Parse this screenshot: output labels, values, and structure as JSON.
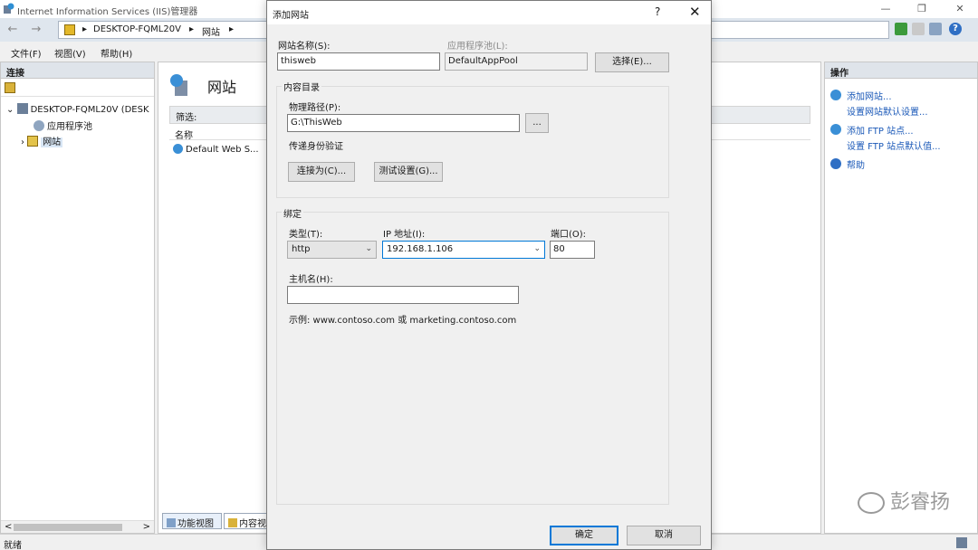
{
  "window": {
    "title": "Internet Information Services (IIS)管理器",
    "minimize_glyph": "—",
    "restore_glyph": "❐",
    "close_glyph": "✕"
  },
  "address": {
    "back_glyph": "←",
    "forward_glyph": "→",
    "sep_glyph": "▸",
    "crumbs": [
      "DESKTOP-FQML20V",
      "网站"
    ],
    "help_glyph": "?"
  },
  "menu": [
    "文件(F)",
    "视图(V)",
    "帮助(H)"
  ],
  "connections": {
    "header": "连接",
    "tree": {
      "server": "DESKTOP-FQML20V (DESK",
      "app_pools": "应用程序池",
      "sites": "网站"
    },
    "expand_glyph": "⌄",
    "collapse_glyph": "›",
    "scroll_left": "<",
    "scroll_right": ">"
  },
  "center": {
    "title": "网站",
    "filter_label": "筛选:",
    "column_name": "名称",
    "rows": [
      "Default Web S..."
    ],
    "tabs": [
      "功能视图",
      "内容视"
    ]
  },
  "actions": {
    "header": "操作",
    "items": [
      "添加网站...",
      "设置网站默认设置...",
      "添加 FTP 站点...",
      "设置 FTP 站点默认值...",
      "帮助"
    ]
  },
  "status": {
    "text": "就绪"
  },
  "watermark": "彭睿扬",
  "dialog": {
    "title": "添加网站",
    "help_glyph": "?",
    "close_glyph": "✕",
    "site_name_label": "网站名称(S):",
    "site_name_value": "thisweb",
    "app_pool_label": "应用程序池(L):",
    "app_pool_value": "DefaultAppPool",
    "select_button": "选择(E)...",
    "content_dir_label": "内容目录",
    "physical_path_label": "物理路径(P):",
    "physical_path_value": "G:\\ThisWeb",
    "browse_button": "...",
    "pass_auth_label": "传递身份验证",
    "connect_as_button": "连接为(C)...",
    "test_settings_button": "测试设置(G)...",
    "binding_label": "绑定",
    "type_label": "类型(T):",
    "type_value": "http",
    "ip_label": "IP 地址(I):",
    "ip_value": "192.168.1.106",
    "port_label": "端口(O):",
    "port_value": "80",
    "host_label": "主机名(H):",
    "host_value": "",
    "example_text": "示例: www.contoso.com 或 marketing.contoso.com",
    "ok_button": "确定",
    "cancel_button": "取消",
    "dropdown_glyph": "⌄"
  },
  "colors": {
    "accent": "#0078d7",
    "link": "#1b59b8",
    "panel_header": "#dfe4ea"
  }
}
